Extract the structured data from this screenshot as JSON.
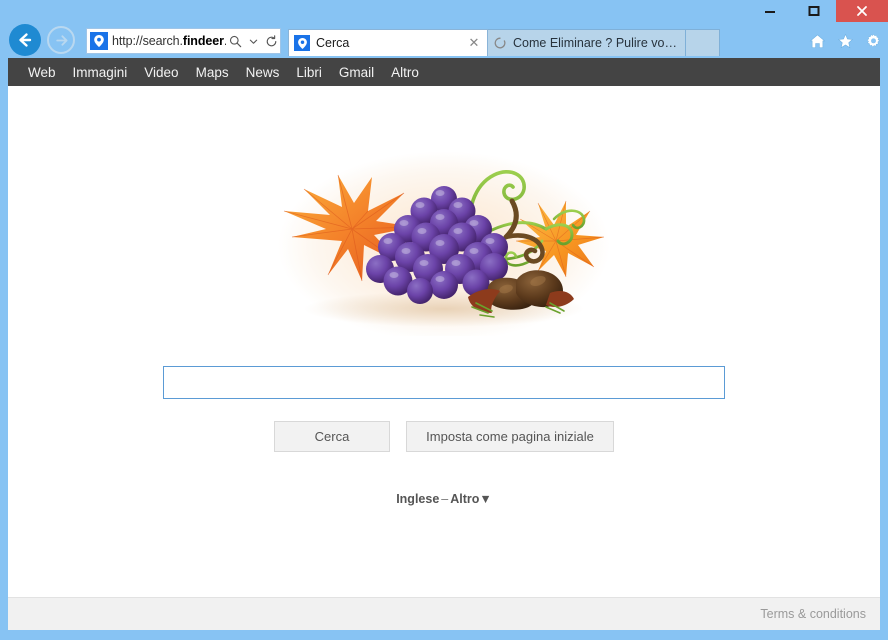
{
  "window": {
    "controls": {
      "minimize": "—",
      "maximize": "▢",
      "close": "✕"
    },
    "accent_color": "#87c3f3",
    "close_color": "#d9534f"
  },
  "browser": {
    "back_label": "Back",
    "forward_label": "Forward",
    "address": {
      "url_prefix": "http://search.",
      "url_domain": "findeer",
      "url_suffix": "....",
      "full_url": "http://search.findeer....",
      "search_icon": "magnifier-icon",
      "dropdown_icon": "chevron-down-icon",
      "refresh_icon": "refresh-icon"
    },
    "tabs": [
      {
        "title": "Cerca",
        "active": true,
        "favicon": "location-pin-icon",
        "close_label": "✕"
      },
      {
        "title": "Come Eliminare ? Pulire vostro...",
        "active": false,
        "favicon": "loading-spinner-icon",
        "close_label": ""
      }
    ],
    "toolbar_icons": [
      {
        "name": "home-icon",
        "label": "Home"
      },
      {
        "name": "star-icon",
        "label": "Favorites"
      },
      {
        "name": "gear-icon",
        "label": "Settings"
      }
    ]
  },
  "site": {
    "nav": [
      {
        "label": "Web"
      },
      {
        "label": "Immagini"
      },
      {
        "label": "Video"
      },
      {
        "label": "Maps"
      },
      {
        "label": "News"
      },
      {
        "label": "Libri"
      },
      {
        "label": "Gmail"
      },
      {
        "label": "Altro"
      }
    ],
    "nav_background": "#444444",
    "logo": {
      "name": "autumn-grapes-illustration",
      "alt": "Grapes, maple leaves and chestnuts illustration"
    },
    "search": {
      "value": "",
      "placeholder": "",
      "search_button": "Cerca",
      "homepage_button": "Imposta come pagina iniziale",
      "border_color": "#5b9bd5"
    },
    "language": {
      "current": "Inglese",
      "separator": "–",
      "more": "Altro",
      "caret": "▼"
    },
    "footer": {
      "terms": "Terms & conditions"
    }
  }
}
